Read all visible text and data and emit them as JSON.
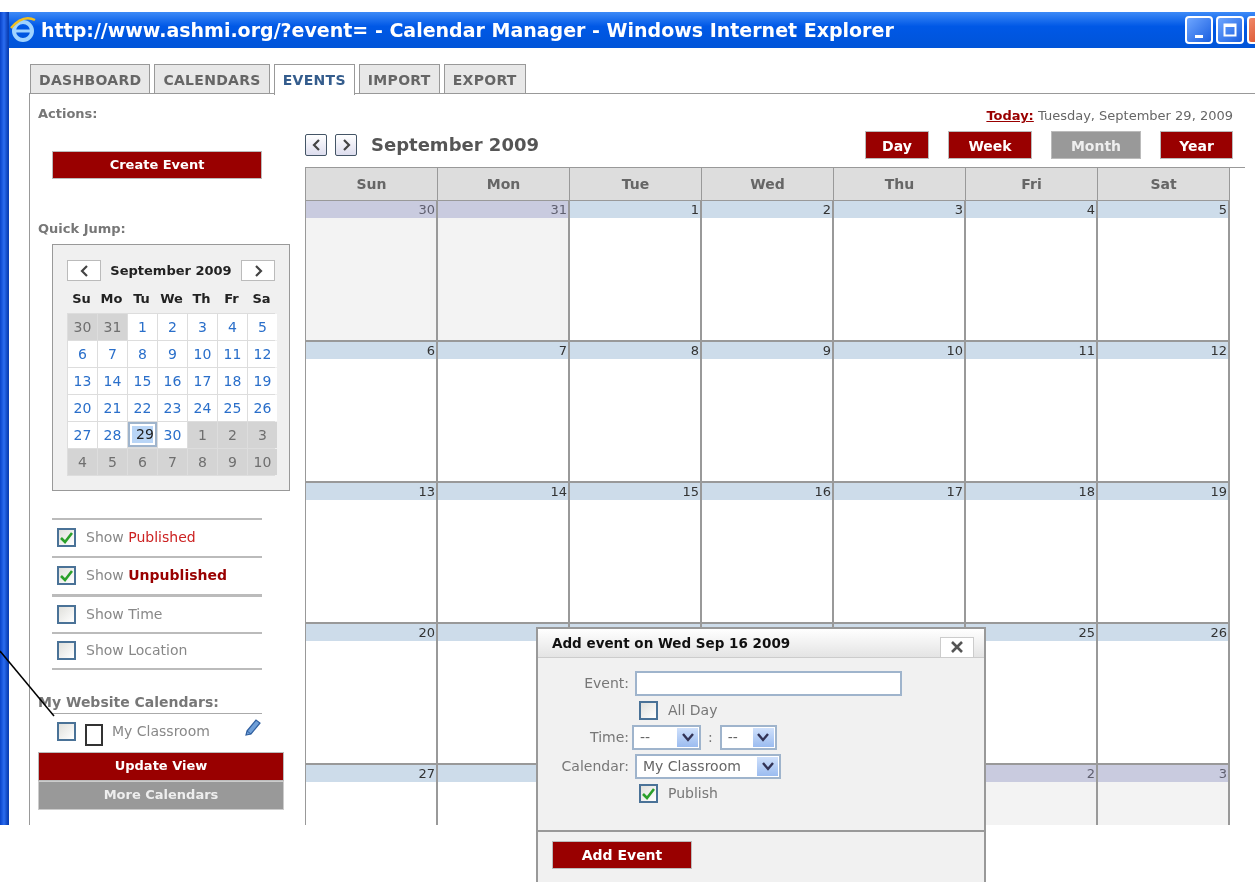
{
  "window": {
    "title": "http://www.ashmi.org/?event= - Calendar Manager - Windows Internet Explorer"
  },
  "tabs": [
    {
      "label": "DASHBOARD",
      "selected": false
    },
    {
      "label": "CALENDARS",
      "selected": false
    },
    {
      "label": "EVENTS",
      "selected": true
    },
    {
      "label": "IMPORT",
      "selected": false
    },
    {
      "label": "EXPORT",
      "selected": false
    }
  ],
  "sidebar": {
    "actions_heading": "Actions:",
    "create_button": "Create Event",
    "quick_jump_heading": "Quick Jump:",
    "mini_calendar": {
      "month": "September 2009",
      "weekdays": [
        "Su",
        "Mo",
        "Tu",
        "We",
        "Th",
        "Fr",
        "Sa"
      ],
      "weeks": [
        [
          {
            "day": "30",
            "other_month": true,
            "selected": false
          },
          {
            "day": "31",
            "other_month": true,
            "selected": false
          },
          {
            "day": "1",
            "other_month": false,
            "selected": false
          },
          {
            "day": "2",
            "other_month": false,
            "selected": false
          },
          {
            "day": "3",
            "other_month": false,
            "selected": false
          },
          {
            "day": "4",
            "other_month": false,
            "selected": false
          },
          {
            "day": "5",
            "other_month": false,
            "selected": false
          }
        ],
        [
          {
            "day": "6",
            "other_month": false,
            "selected": false
          },
          {
            "day": "7",
            "other_month": false,
            "selected": false
          },
          {
            "day": "8",
            "other_month": false,
            "selected": false
          },
          {
            "day": "9",
            "other_month": false,
            "selected": false
          },
          {
            "day": "10",
            "other_month": false,
            "selected": false
          },
          {
            "day": "11",
            "other_month": false,
            "selected": false
          },
          {
            "day": "12",
            "other_month": false,
            "selected": false
          }
        ],
        [
          {
            "day": "13",
            "other_month": false,
            "selected": false
          },
          {
            "day": "14",
            "other_month": false,
            "selected": false
          },
          {
            "day": "15",
            "other_month": false,
            "selected": false
          },
          {
            "day": "16",
            "other_month": false,
            "selected": false
          },
          {
            "day": "17",
            "other_month": false,
            "selected": false
          },
          {
            "day": "18",
            "other_month": false,
            "selected": false
          },
          {
            "day": "19",
            "other_month": false,
            "selected": false
          }
        ],
        [
          {
            "day": "20",
            "other_month": false,
            "selected": false
          },
          {
            "day": "21",
            "other_month": false,
            "selected": false
          },
          {
            "day": "22",
            "other_month": false,
            "selected": false
          },
          {
            "day": "23",
            "other_month": false,
            "selected": false
          },
          {
            "day": "24",
            "other_month": false,
            "selected": false
          },
          {
            "day": "25",
            "other_month": false,
            "selected": false
          },
          {
            "day": "26",
            "other_month": false,
            "selected": false
          }
        ],
        [
          {
            "day": "27",
            "other_month": false,
            "selected": false
          },
          {
            "day": "28",
            "other_month": false,
            "selected": false
          },
          {
            "day": "29",
            "other_month": false,
            "selected": true
          },
          {
            "day": "30",
            "other_month": false,
            "selected": false
          },
          {
            "day": "1",
            "other_month": true,
            "selected": false
          },
          {
            "day": "2",
            "other_month": true,
            "selected": false
          },
          {
            "day": "3",
            "other_month": true,
            "selected": false
          }
        ],
        [
          {
            "day": "4",
            "other_month": true,
            "selected": false
          },
          {
            "day": "5",
            "other_month": true,
            "selected": false
          },
          {
            "day": "6",
            "other_month": true,
            "selected": false
          },
          {
            "day": "7",
            "other_month": true,
            "selected": false
          },
          {
            "day": "8",
            "other_month": true,
            "selected": false
          },
          {
            "day": "9",
            "other_month": true,
            "selected": false
          },
          {
            "day": "10",
            "other_month": true,
            "selected": false
          }
        ]
      ]
    },
    "filters": [
      {
        "label": "Show",
        "highlight": "Published",
        "highlight_bold": false,
        "checked": true
      },
      {
        "label": "Show",
        "highlight": "Unpublished",
        "highlight_bold": true,
        "checked": true
      },
      {
        "label": "Show Time",
        "checked": false
      },
      {
        "label": "Show Location",
        "checked": false
      }
    ],
    "calendars_heading": "My Website Calendars:",
    "calendars": [
      {
        "name": "My Classroom",
        "checked": false
      }
    ],
    "update_button": "Update View",
    "more_button": "More Calendars"
  },
  "main": {
    "today_label": "Today:",
    "today_value": "Tuesday, September 29, 2009",
    "month_title": "September 2009",
    "views": [
      {
        "label": "Day",
        "selected": false
      },
      {
        "label": "Week",
        "selected": false
      },
      {
        "label": "Month",
        "selected": true
      },
      {
        "label": "Year",
        "selected": false
      }
    ],
    "weekdays": [
      "Sun",
      "Mon",
      "Tue",
      "Wed",
      "Thu",
      "Fri",
      "Sat"
    ],
    "weeks": [
      {
        "days": [
          {
            "day": "30",
            "other_month": true
          },
          {
            "day": "31",
            "other_month": true
          },
          {
            "day": "1",
            "other_month": false
          },
          {
            "day": "2",
            "other_month": false
          },
          {
            "day": "3",
            "other_month": false
          },
          {
            "day": "4",
            "other_month": false
          },
          {
            "day": "5",
            "other_month": false
          }
        ]
      },
      {
        "days": [
          {
            "day": "6",
            "other_month": false
          },
          {
            "day": "7",
            "other_month": false
          },
          {
            "day": "8",
            "other_month": false
          },
          {
            "day": "9",
            "other_month": false
          },
          {
            "day": "10",
            "other_month": false
          },
          {
            "day": "11",
            "other_month": false
          },
          {
            "day": "12",
            "other_month": false
          }
        ]
      },
      {
        "days": [
          {
            "day": "13",
            "other_month": false
          },
          {
            "day": "14",
            "other_month": false
          },
          {
            "day": "15",
            "other_month": false
          },
          {
            "day": "16",
            "other_month": false
          },
          {
            "day": "17",
            "other_month": false
          },
          {
            "day": "18",
            "other_month": false
          },
          {
            "day": "19",
            "other_month": false
          }
        ]
      },
      {
        "days": [
          {
            "day": "20",
            "other_month": false
          },
          {
            "other_month": false
          }
        ],
        "days_right_of_dialog": [
          {
            "day": "25",
            "other_month": false
          },
          {
            "day": "26",
            "other_month": false
          }
        ]
      },
      {
        "days": [
          {
            "day": "27",
            "other_month": false
          },
          {
            "other_month": false
          }
        ],
        "days_right_of_dialog": [
          {
            "day": "2",
            "other_month": true
          },
          {
            "day": "3",
            "other_month": true
          }
        ]
      }
    ]
  },
  "dialog": {
    "title": "Add event on Wed Sep 16 2009",
    "event_label": "Event:",
    "all_day": {
      "label": "All Day",
      "checked": false
    },
    "time_label": "Time:",
    "hour": "--",
    "separator": ":",
    "minute": "--",
    "calendar_label": "Calendar:",
    "calendar_value": "My Classroom",
    "publish": {
      "label": "Publish",
      "checked": true
    },
    "submit": "Add Event"
  }
}
